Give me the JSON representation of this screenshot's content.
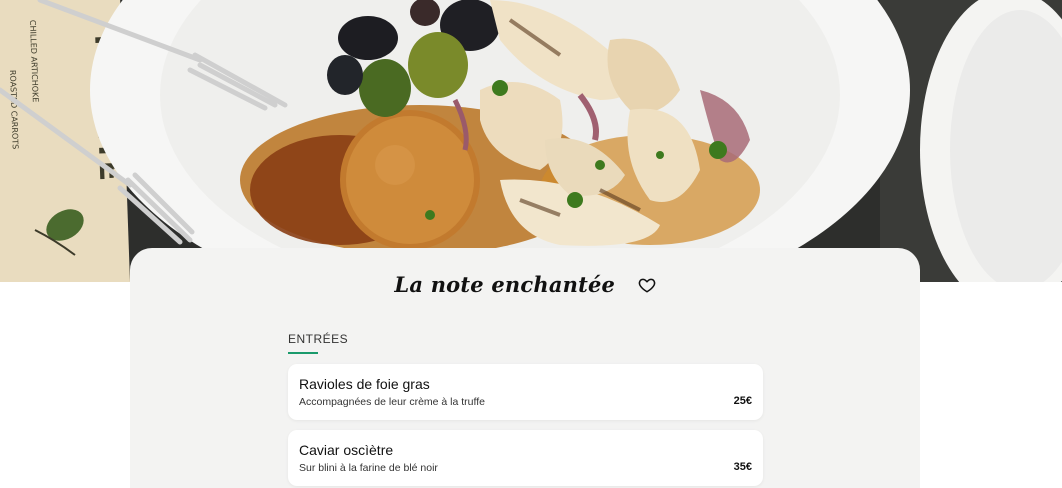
{
  "restaurant": {
    "name": "La note enchantée",
    "favorite_icon": "heart-outline-icon"
  },
  "hero": {
    "image_alt": "Plat de calamars grillés, olives et croquette",
    "menu_board_words": [
      "THE BITE",
      "CHILLED ARTICHOKE",
      "ROASTED CARROTS"
    ]
  },
  "menu": {
    "section_label": "ENTRÉES",
    "accent_color": "#1a9a6c",
    "items": [
      {
        "name": "Ravioles de foie gras",
        "description": "Accompagnées de leur crème à la truffe",
        "price": "25€"
      },
      {
        "name": "Caviar oscìètre",
        "description": "Sur blini à la farine de blé noir",
        "price": "35€"
      }
    ]
  }
}
